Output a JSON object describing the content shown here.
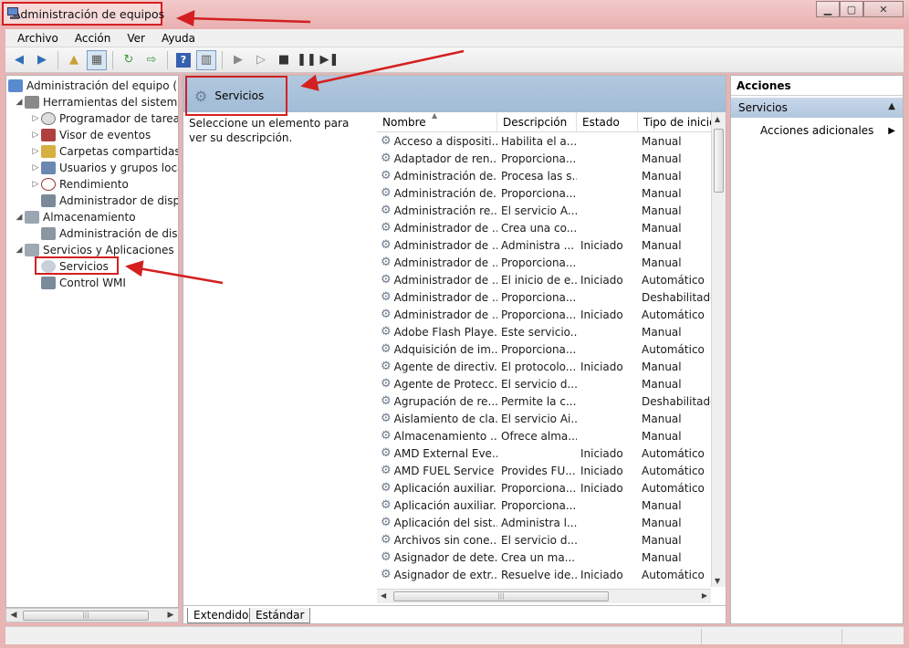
{
  "window": {
    "title": "Administración de equipos",
    "controls": {
      "minimize": "▁",
      "restore": "▢",
      "close": "✕"
    }
  },
  "menu": [
    "Archivo",
    "Acción",
    "Ver",
    "Ayuda"
  ],
  "tree": [
    {
      "label": "Administración del equipo (loc",
      "level": 0,
      "arrow": "",
      "icon": "computer-management-icon"
    },
    {
      "label": "Herramientas del sistema",
      "level": 1,
      "arrow": "◢",
      "icon": "tools-icon"
    },
    {
      "label": "Programador de tareas",
      "level": 2,
      "arrow": "▷",
      "icon": "clock-icon"
    },
    {
      "label": "Visor de eventos",
      "level": 2,
      "arrow": "▷",
      "icon": "event-viewer-icon"
    },
    {
      "label": "Carpetas compartidas",
      "level": 2,
      "arrow": "▷",
      "icon": "shared-folder-icon"
    },
    {
      "label": "Usuarios y grupos locale",
      "level": 2,
      "arrow": "▷",
      "icon": "users-icon"
    },
    {
      "label": "Rendimiento",
      "level": 2,
      "arrow": "▷",
      "icon": "performance-icon"
    },
    {
      "label": "Administrador de dispo",
      "level": 2,
      "arrow": "",
      "icon": "device-manager-icon"
    },
    {
      "label": "Almacenamiento",
      "level": 1,
      "arrow": "◢",
      "icon": "storage-icon"
    },
    {
      "label": "Administración de disco",
      "level": 2,
      "arrow": "",
      "icon": "disk-icon"
    },
    {
      "label": "Servicios y Aplicaciones",
      "level": 1,
      "arrow": "◢",
      "icon": "services-apps-icon"
    },
    {
      "label": "Servicios",
      "level": 2,
      "arrow": "",
      "icon": "gear-icon"
    },
    {
      "label": "Control WMI",
      "level": 2,
      "arrow": "",
      "icon": "wmi-icon"
    }
  ],
  "center": {
    "header": "Servicios",
    "description": "Seleccione un elemento para ver su descripción.",
    "columns": [
      "Nombre",
      "Descripción",
      "Estado",
      "Tipo de inicio"
    ],
    "rows": [
      [
        "Acceso a dispositi...",
        "Habilita el a...",
        "",
        "Manual"
      ],
      [
        "Adaptador de ren...",
        "Proporciona...",
        "",
        "Manual"
      ],
      [
        "Administración de...",
        "Procesa las s...",
        "",
        "Manual"
      ],
      [
        "Administración de...",
        "Proporciona...",
        "",
        "Manual"
      ],
      [
        "Administración re...",
        "El servicio A...",
        "",
        "Manual"
      ],
      [
        "Administrador de ...",
        "Crea una co...",
        "",
        "Manual"
      ],
      [
        "Administrador de ...",
        "Administra ...",
        "Iniciado",
        "Manual"
      ],
      [
        "Administrador de ...",
        "Proporciona...",
        "",
        "Manual"
      ],
      [
        "Administrador de ...",
        "El inicio de e...",
        "Iniciado",
        "Automático"
      ],
      [
        "Administrador de ...",
        "Proporciona...",
        "",
        "Deshabilitado"
      ],
      [
        "Administrador de ...",
        "Proporciona...",
        "Iniciado",
        "Automático"
      ],
      [
        "Adobe Flash Playe...",
        "Este servicio...",
        "",
        "Manual"
      ],
      [
        "Adquisición de im...",
        "Proporciona...",
        "",
        "Automático"
      ],
      [
        "Agente de directiv...",
        "El protocolo...",
        "Iniciado",
        "Manual"
      ],
      [
        "Agente de Protecc...",
        "El servicio d...",
        "",
        "Manual"
      ],
      [
        "Agrupación de re...",
        "Permite la c...",
        "",
        "Deshabilitado"
      ],
      [
        "Aislamiento de cla...",
        "El servicio Ai...",
        "",
        "Manual"
      ],
      [
        "Almacenamiento ...",
        "Ofrece alma...",
        "",
        "Manual"
      ],
      [
        "AMD External Eve...",
        "",
        "Iniciado",
        "Automático"
      ],
      [
        "AMD FUEL Service",
        "Provides FU...",
        "Iniciado",
        "Automático"
      ],
      [
        "Aplicación auxiliar...",
        "Proporciona...",
        "Iniciado",
        "Automático"
      ],
      [
        "Aplicación auxiliar...",
        "Proporciona...",
        "",
        "Manual"
      ],
      [
        "Aplicación del sist...",
        "Administra l...",
        "",
        "Manual"
      ],
      [
        "Archivos sin cone...",
        "El servicio d...",
        "",
        "Manual"
      ],
      [
        "Asignador de dete...",
        "Crea un ma...",
        "",
        "Manual"
      ],
      [
        "Asignador de extr...",
        "Resuelve ide...",
        "Iniciado",
        "Automático"
      ]
    ],
    "tabs": [
      "Extendido",
      "Estándar"
    ]
  },
  "actions": {
    "title": "Acciones",
    "section": "Servicios",
    "item": "Acciones adicionales"
  }
}
